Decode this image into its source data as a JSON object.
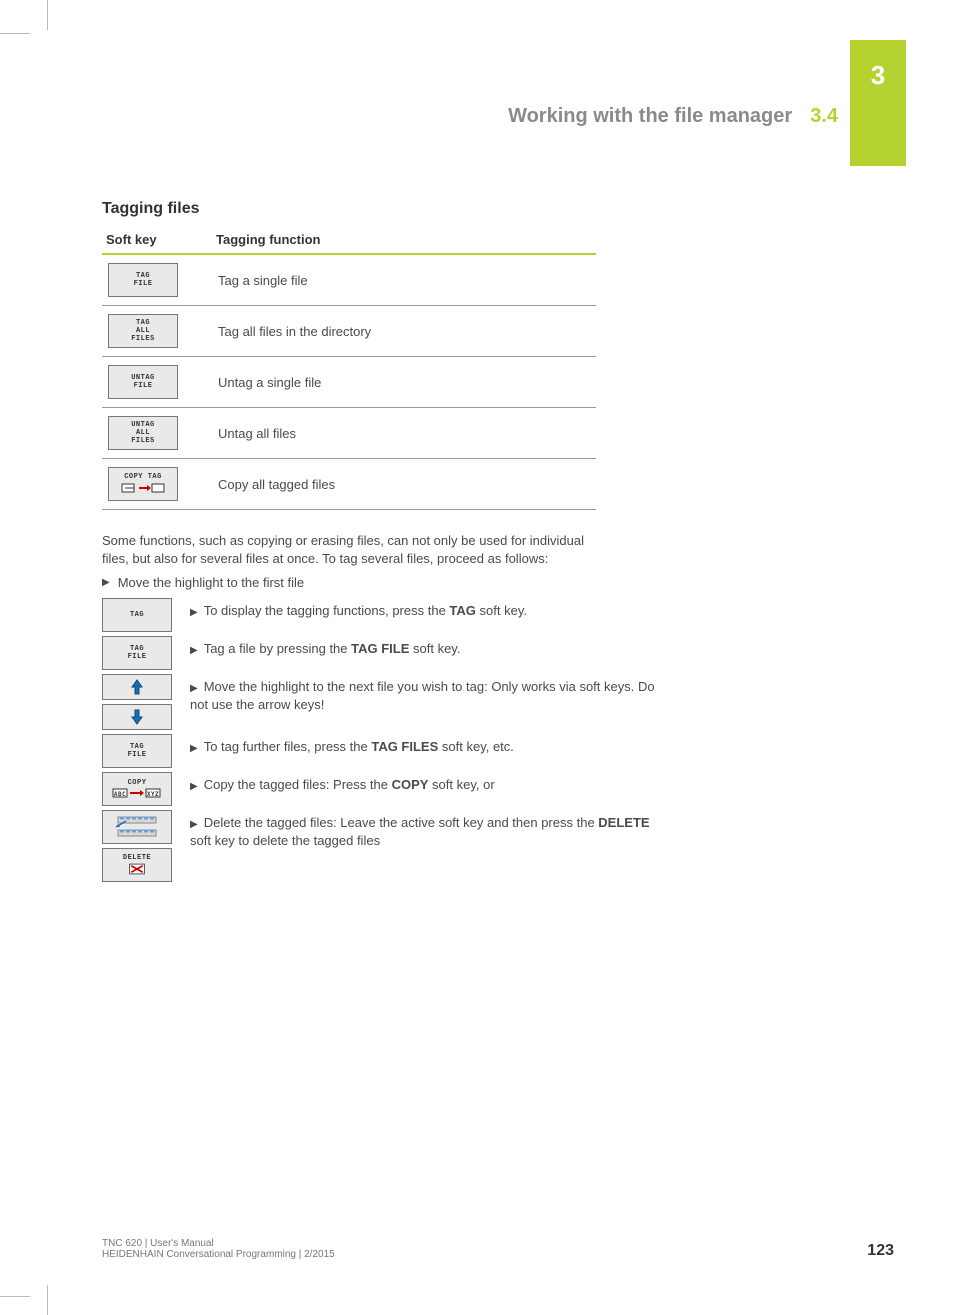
{
  "tab": {
    "chapter": "3"
  },
  "header": {
    "title": "Working with the file manager",
    "section": "3.4"
  },
  "subhead": "Tagging files",
  "table": {
    "col1": "Soft key",
    "col2": "Tagging function",
    "rows": [
      {
        "key_lines": [
          "TAG",
          "FILE"
        ],
        "desc": "Tag a single file"
      },
      {
        "key_lines": [
          "TAG",
          "ALL",
          "FILES"
        ],
        "desc": "Tag all files in the directory"
      },
      {
        "key_lines": [
          "UNTAG",
          "FILE"
        ],
        "desc": "Untag a single file"
      },
      {
        "key_lines": [
          "UNTAG",
          "ALL",
          "FILES"
        ],
        "desc": "Untag all files"
      },
      {
        "key_lines": [
          "COPY TAG"
        ],
        "icon": "copy-tag",
        "desc": "Copy all tagged files"
      }
    ]
  },
  "paragraph": "Some functions, such as copying or erasing files, can not only be used for individual files, but also for several files at once. To tag several files, proceed as follows:",
  "first_bullet": "Move the highlight to the first file",
  "steps": [
    {
      "keys": [
        {
          "type": "label",
          "lines": [
            "TAG"
          ]
        }
      ],
      "pre": "To display the tagging functions, press the ",
      "bold": "TAG",
      "post": " soft key."
    },
    {
      "keys": [
        {
          "type": "label",
          "lines": [
            "TAG",
            "FILE"
          ]
        }
      ],
      "pre": "Tag a file by pressing the ",
      "bold": "TAG FILE",
      "post": " soft key."
    },
    {
      "keys": [
        {
          "type": "arrow-up"
        },
        {
          "type": "arrow-down"
        }
      ],
      "pre": "Move the highlight to the next file you wish to tag: Only works via soft keys. Do not use the arrow keys!",
      "bold": "",
      "post": ""
    },
    {
      "keys": [
        {
          "type": "label",
          "lines": [
            "TAG",
            "FILE"
          ]
        }
      ],
      "pre": "To tag further files, press the ",
      "bold": "TAG FILES",
      "post": " soft key, etc."
    },
    {
      "keys": [
        {
          "type": "copy"
        }
      ],
      "pre": "Copy the tagged files: Press the ",
      "bold": "COPY",
      "post": " soft key, or"
    },
    {
      "keys": [
        {
          "type": "back"
        },
        {
          "type": "delete"
        }
      ],
      "pre": "Delete the tagged files: Leave the active soft key and then press the ",
      "bold": "DELETE",
      "post": " soft key to delete the tagged files"
    }
  ],
  "footer": {
    "line1": "TNC 620 | User's Manual",
    "line2": "HEIDENHAIN Conversational Programming | 2/2015",
    "page": "123"
  }
}
